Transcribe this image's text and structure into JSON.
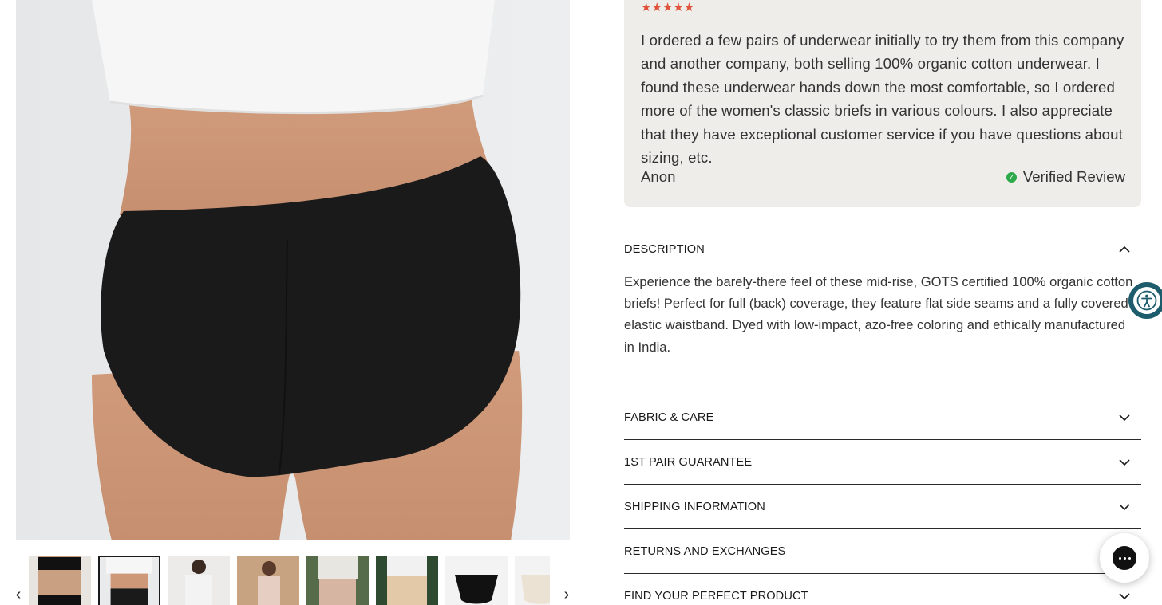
{
  "review": {
    "stars": "★★★★★",
    "text": "I ordered a few pairs of underwear initially to try them from this company and another company, both selling 100% organic cotton underwear. I found these underwear hands down the most comfortable, so I ordered more of the women's classic briefs in various colours. I also appreciate that they have exceptional customer service if you have questions about sizing, etc.",
    "author": "Anon",
    "verified_label": "Verified Review"
  },
  "accordion": {
    "description": {
      "title": "DESCRIPTION",
      "body": "Experience the barely-there feel of these mid-rise, GOTS certified 100% organic cotton briefs! Perfect for full (back) coverage, they feature flat side seams and a fully covered elastic waistband. Dyed with low-impact, azo-free coloring and ethically manufactured in India.",
      "expanded": true
    },
    "items": [
      {
        "title": "FABRIC & CARE"
      },
      {
        "title": "1ST PAIR GUARANTEE"
      },
      {
        "title": "SHIPPING INFORMATION"
      },
      {
        "title": "RETURNS AND EXCHANGES"
      },
      {
        "title": "FIND YOUR PERFECT PRODUCT"
      }
    ]
  },
  "gallery": {
    "thumbnail_count": 8,
    "selected_index": 1
  },
  "icons": {
    "prev": "chevron-left-icon",
    "next": "chevron-right-icon",
    "expand": "chevron-down-icon",
    "collapse": "chevron-up-icon",
    "accessibility": "accessibility-icon",
    "chat": "chat-icon",
    "verified": "check-circle-icon"
  },
  "colors": {
    "star": "#e0533a",
    "verified": "#2eaa4a",
    "review_bg": "#efedea",
    "accessibility": "#1c5c6c"
  }
}
